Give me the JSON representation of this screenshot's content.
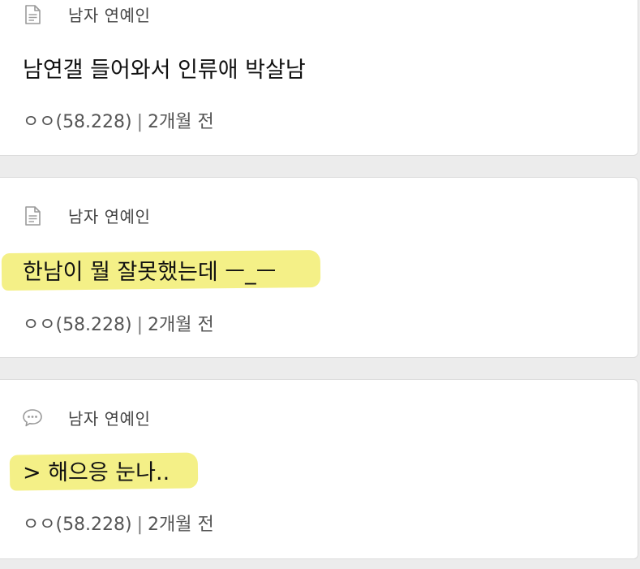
{
  "posts": [
    {
      "icon": "document-icon",
      "board": "남자 연예인",
      "title": "남연갤 들어와서 인류애 박살남",
      "author": "ㅇㅇ(58.228)",
      "separator": "|",
      "time": "2개월 전",
      "highlighted": false
    },
    {
      "icon": "document-icon",
      "board": "남자 연예인",
      "title": "한남이 뭘 잘못했는데 ㅡ_ㅡ",
      "author": "ㅇㅇ(58.228)",
      "separator": "|",
      "time": "2개월 전",
      "highlighted": true
    },
    {
      "icon": "speech-bubble-icon",
      "board": "남자 연예인",
      "title": "> 해으응 눈나..",
      "author": "ㅇㅇ(58.228)",
      "separator": "|",
      "time": "2개월 전",
      "highlighted": true
    }
  ],
  "colors": {
    "highlight": "#f3ee7a",
    "card_bg": "#ffffff",
    "page_bg": "#ececec"
  }
}
